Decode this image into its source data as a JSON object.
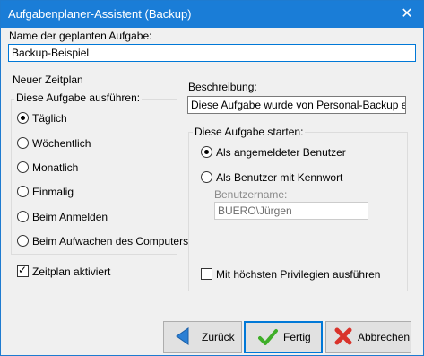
{
  "window": {
    "title": "Aufgabenplaner-Assistent (Backup)",
    "close_glyph": "✕"
  },
  "task": {
    "name_label": "Name der geplanten Aufgabe:",
    "name_value": "Backup-Beispiel"
  },
  "schedule": {
    "header": "Neuer Zeitplan",
    "group_title": "Diese Aufgabe ausführen:",
    "options": [
      {
        "label": "Täglich",
        "selected": true
      },
      {
        "label": "Wöchentlich",
        "selected": false
      },
      {
        "label": "Monatlich",
        "selected": false
      },
      {
        "label": "Einmalig",
        "selected": false
      },
      {
        "label": "Beim Anmelden",
        "selected": false
      },
      {
        "label": "Beim Aufwachen des Computers",
        "selected": false
      }
    ],
    "active_label": "Zeitplan aktiviert",
    "active_checked": true
  },
  "description": {
    "label": "Beschreibung:",
    "value": "Diese Aufgabe wurde von Personal-Backup erstellt"
  },
  "start": {
    "group_title": "Diese Aufgabe starten:",
    "as_logged_in_label": "Als angemeldeter Benutzer",
    "as_logged_in_selected": true,
    "as_user_label": "Als Benutzer mit Kennwort",
    "as_user_selected": false,
    "username_label": "Benutzername:",
    "username_value": "BUERO\\Jürgen",
    "highest_priv_label": "Mit höchsten Privilegien ausführen",
    "highest_priv_checked": false
  },
  "buttons": {
    "back": "Zurück",
    "finish": "Fertig",
    "cancel": "Abbrechen"
  },
  "colors": {
    "titlebar": "#1a7dd7",
    "back_icon": "#2b7fd4",
    "finish_icon": "#3fae29",
    "cancel_icon": "#d9332b"
  }
}
